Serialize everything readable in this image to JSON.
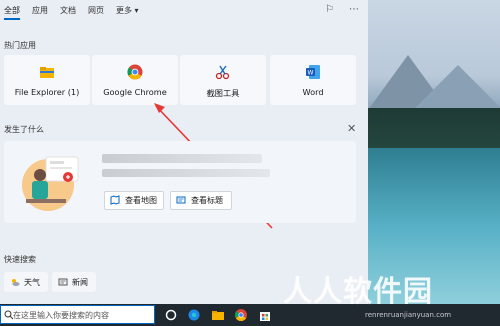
{
  "tabs": [
    "全部",
    "应用",
    "文档",
    "网页",
    "更多 ▾"
  ],
  "top_icons": [
    "feedback-icon",
    "more-icon"
  ],
  "hot_apps": {
    "title": "热门应用",
    "items": [
      {
        "label": "File Explorer (1)",
        "icon": "folder-icon"
      },
      {
        "label": "Google Chrome",
        "icon": "chrome-icon"
      },
      {
        "label": "截图工具",
        "icon": "snipping-tool-icon"
      },
      {
        "label": "Word",
        "icon": "word-icon"
      }
    ]
  },
  "happening": {
    "title": "发生了什么",
    "close_icon": "close-icon",
    "buttons": [
      {
        "label": "查看地图",
        "icon": "map-icon"
      },
      {
        "label": "查看标题",
        "icon": "news-icon"
      }
    ]
  },
  "quick_search": {
    "title": "快速搜索",
    "items": [
      {
        "label": "天气",
        "icon": "weather-icon"
      },
      {
        "label": "新闻",
        "icon": "news-icon"
      }
    ]
  },
  "taskbar": {
    "search_placeholder": "在这里输入你要搜索的内容",
    "icons": [
      "cortana-icon",
      "task-view-icon",
      "edge-icon",
      "file-explorer-icon",
      "chrome-icon",
      "store-icon"
    ]
  },
  "watermark": {
    "text": "人人软件园",
    "sub": "renrenruanjianyuan.com"
  },
  "colors": {
    "accent": "#0067c0",
    "arrow": "#e53935"
  }
}
